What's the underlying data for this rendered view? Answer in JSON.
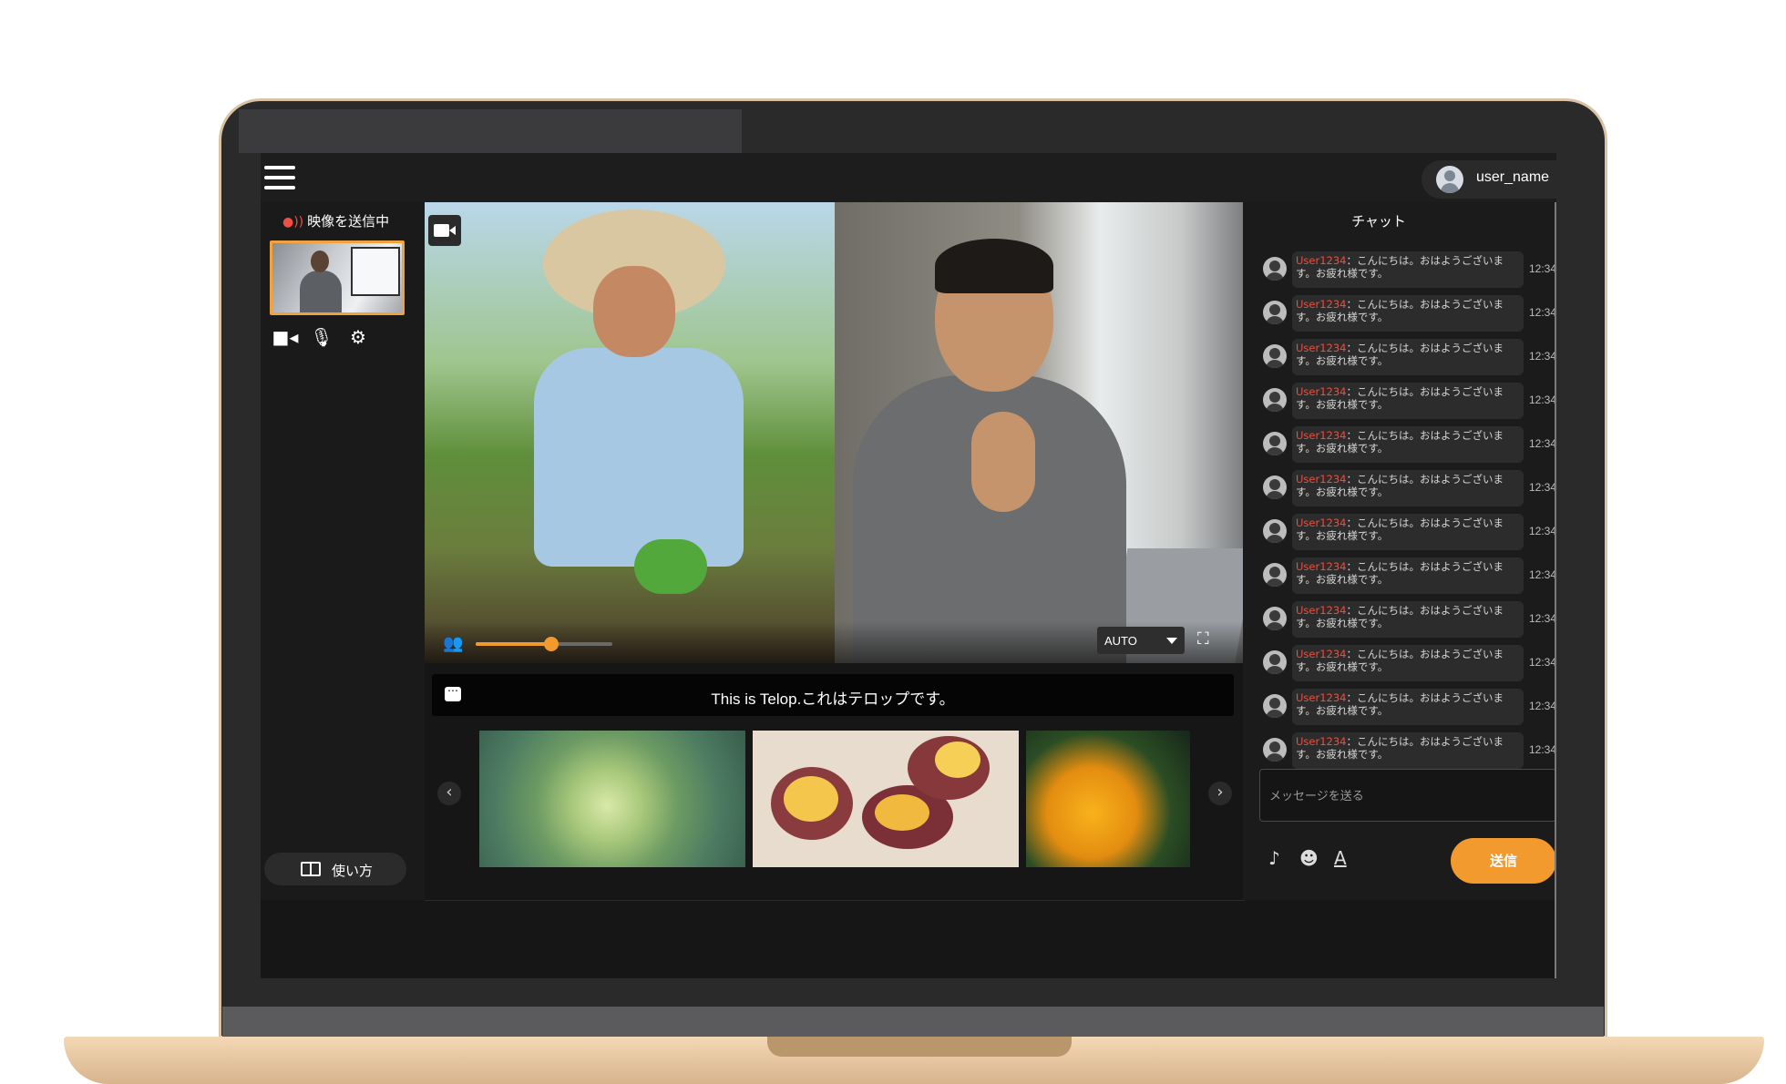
{
  "colors": {
    "accent": "#f29a2e",
    "username": "#e8503f",
    "background": "#161616"
  },
  "header": {
    "user_name": "user_name",
    "menu_icon": "hamburger-menu-icon",
    "avatar_icon": "user-avatar-icon"
  },
  "sidebar": {
    "status_label": "映像を送信中",
    "controls": [
      "video-camera-icon",
      "microphone-icon",
      "gear-icon"
    ],
    "howto_label": "使い方"
  },
  "video": {
    "quality_label": "AUTO",
    "volume_level": 0.55
  },
  "telop": {
    "text": "This is Telop.これはテロップです。"
  },
  "carousel": {
    "items": [
      "cabbage",
      "sweet-potato",
      "pumpkin"
    ]
  },
  "chat": {
    "title": "チャット",
    "messages": [
      {
        "user": "User1234",
        "text": "：こんにちは。おはようございます。お疲れ様です。",
        "time": "12:34"
      },
      {
        "user": "User1234",
        "text": "：こんにちは。おはようございます。お疲れ様です。",
        "time": "12:34"
      },
      {
        "user": "User1234",
        "text": "：こんにちは。おはようございます。お疲れ様です。",
        "time": "12:34"
      },
      {
        "user": "User1234",
        "text": "：こんにちは。おはようございます。お疲れ様です。",
        "time": "12:34"
      },
      {
        "user": "User1234",
        "text": "：こんにちは。おはようございます。お疲れ様です。",
        "time": "12:34"
      },
      {
        "user": "User1234",
        "text": "：こんにちは。おはようございます。お疲れ様です。",
        "time": "12:34"
      },
      {
        "user": "User1234",
        "text": "：こんにちは。おはようございます。お疲れ様です。",
        "time": "12:34"
      },
      {
        "user": "User1234",
        "text": "：こんにちは。おはようございます。お疲れ様です。",
        "time": "12:34"
      },
      {
        "user": "User1234",
        "text": "：こんにちは。おはようございます。お疲れ様です。",
        "time": "12:34"
      },
      {
        "user": "User1234",
        "text": "：こんにちは。おはようございます。お疲れ様です。",
        "time": "12:34"
      },
      {
        "user": "User1234",
        "text": "：こんにちは。おはようございます。お疲れ様です。",
        "time": "12:34"
      },
      {
        "user": "User1234",
        "text": "：こんにちは。おはようございます。お疲れ様です。",
        "time": "12:34"
      }
    ],
    "input_placeholder": "メッセージを送る",
    "tools": [
      "music-note-icon",
      "emoji-icon",
      "text-format-icon"
    ],
    "send_label": "送信"
  }
}
